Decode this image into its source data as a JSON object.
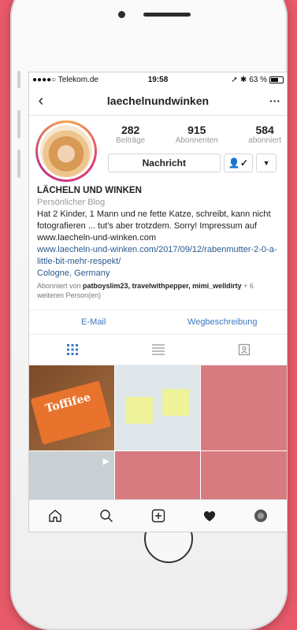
{
  "status": {
    "carrier": "●●●●○ Telekom.de",
    "time": "19:58",
    "battery": "63 %"
  },
  "nav": {
    "title": "laechelnundwinken",
    "more": "···"
  },
  "stats": [
    {
      "num": "282",
      "label": "Beiträge"
    },
    {
      "num": "915",
      "label": "Abonnenten"
    },
    {
      "num": "584",
      "label": "abonniert"
    }
  ],
  "actions": {
    "message": "Nachricht"
  },
  "bio": {
    "name": "LÄCHELN UND WINKEN",
    "category": "Persönlicher Blog",
    "text": "Hat 2 Kinder, 1 Mann und ne fette Katze, schreibt, kann nicht fotografieren ... tut's aber trotzdem. Sorry! Impressum auf www.laecheln-und-winken.com",
    "link": "www.laecheln-und-winken.com/2017/09/12/rabenmutter-2-0-a-little-bit-mehr-respekt/",
    "location": "Cologne, Germany",
    "followed_prefix": "Abonniert von ",
    "followed_names": "patboyslim23, travelwithpepper, mimi_welldirty",
    "followed_suffix": " + 6 weiteren Person(en)"
  },
  "contact": {
    "email": "E-Mail",
    "directions": "Wegbeschreibung"
  },
  "grid": {
    "toffifee": "Toffifee"
  },
  "colors": {
    "accent": "#3a78c2",
    "background": "#e85a6a",
    "tile_pink": "#d87b80"
  },
  "icons": [
    "back-icon",
    "more-icon",
    "grid-icon",
    "list-icon",
    "tagged-icon",
    "home-icon",
    "search-icon",
    "add-icon",
    "heart-icon",
    "profile-icon"
  ]
}
